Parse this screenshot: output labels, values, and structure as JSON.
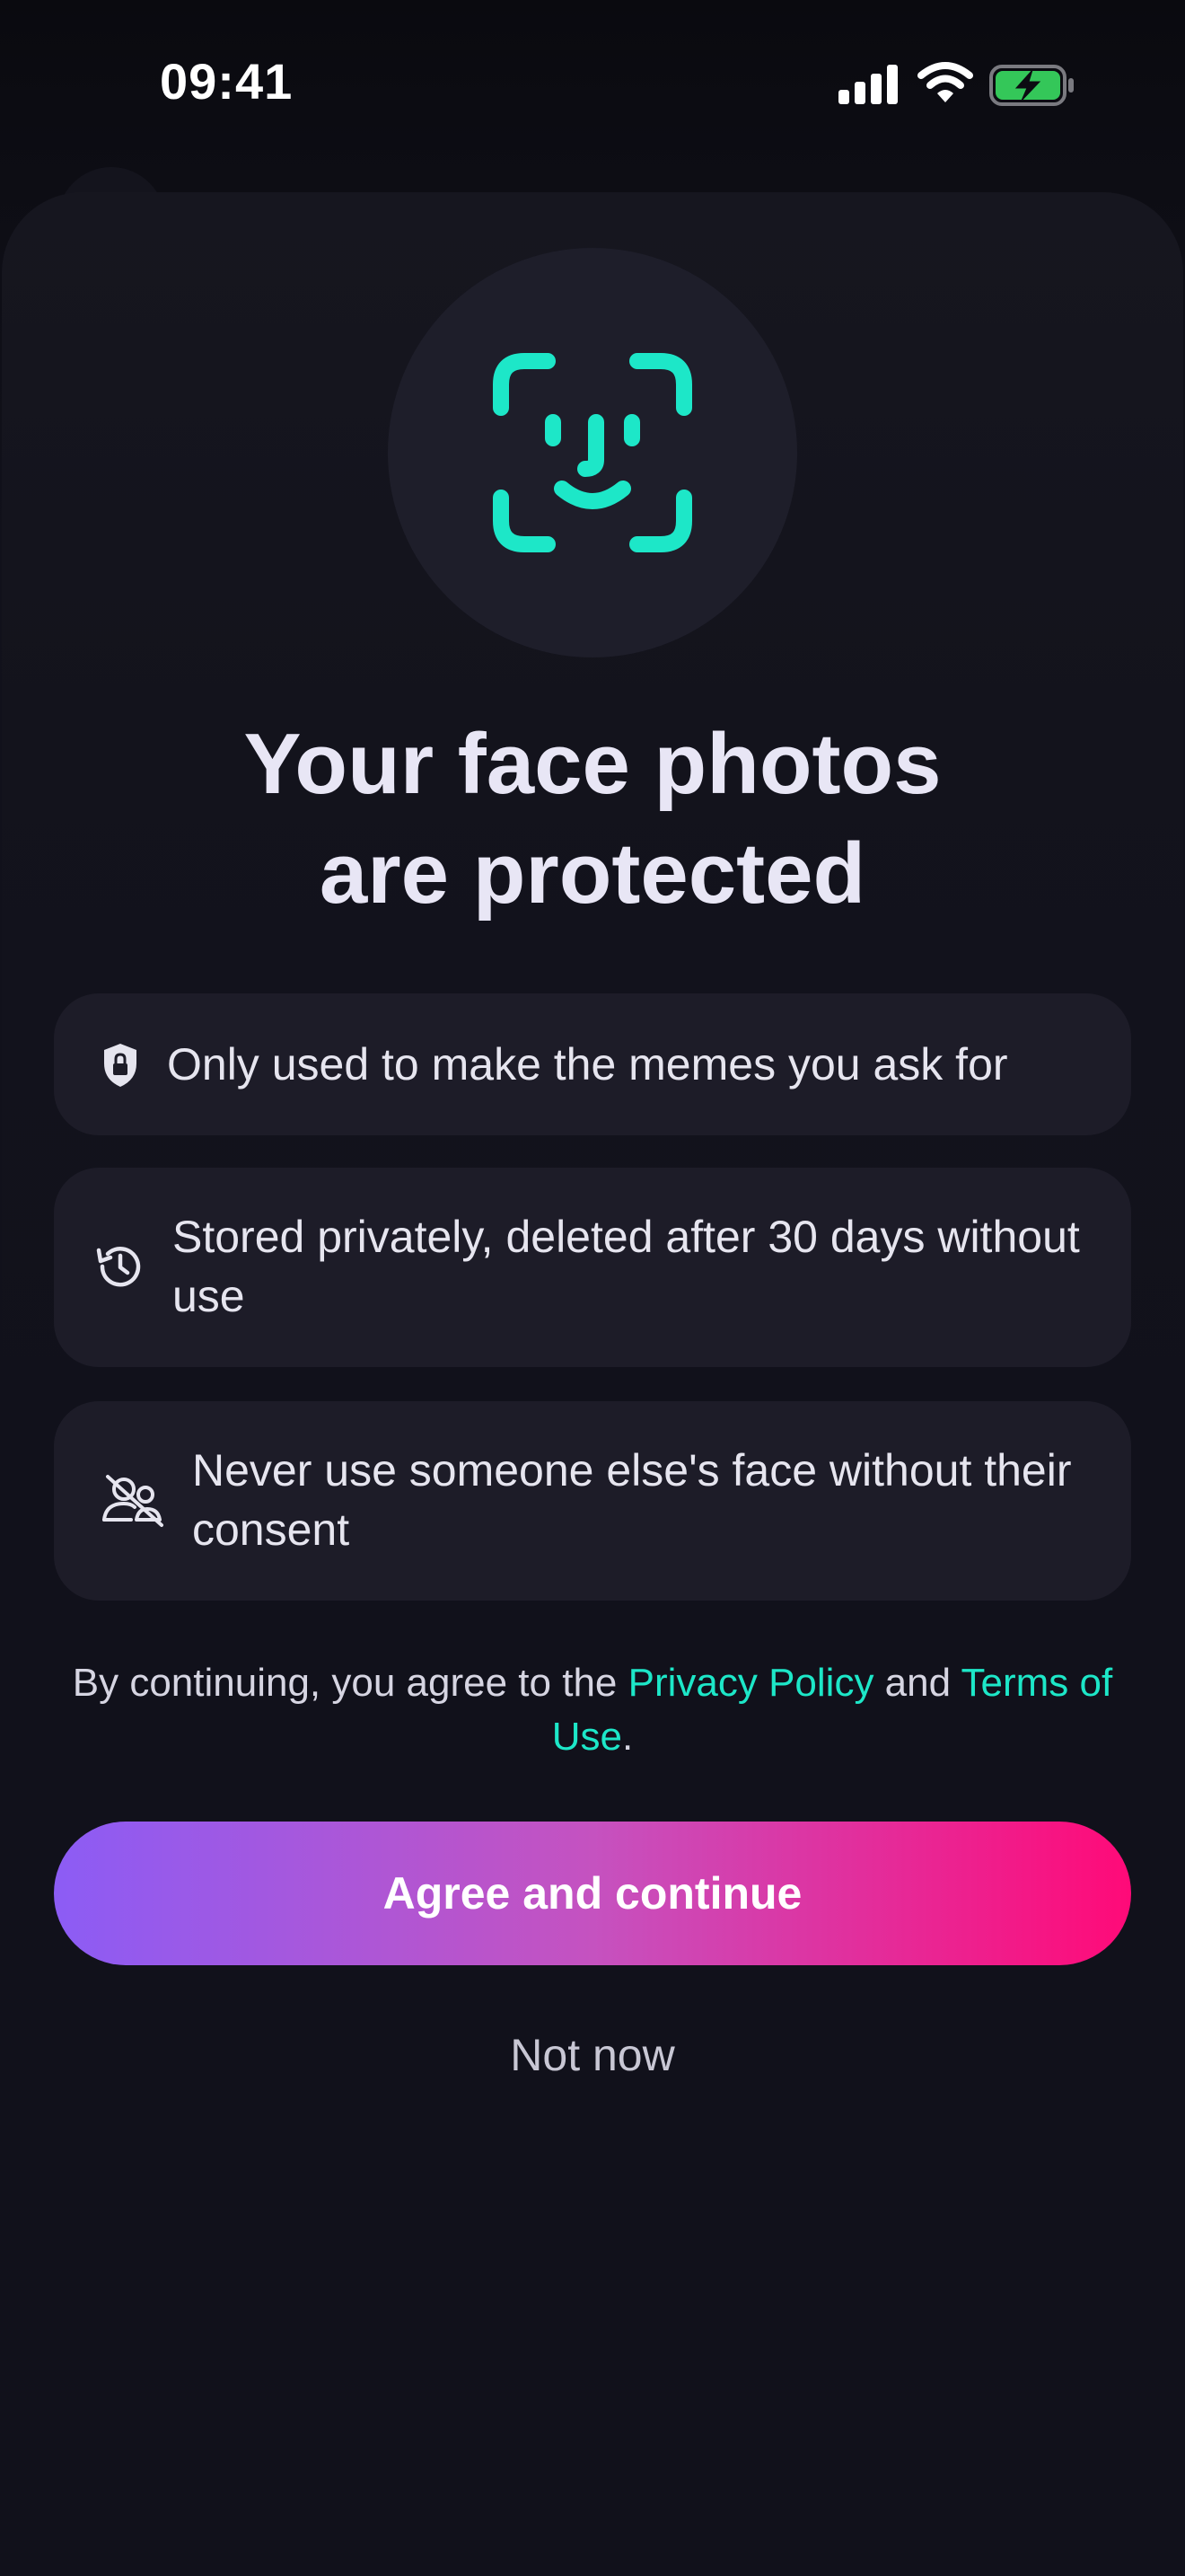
{
  "status_bar": {
    "time": "09:41",
    "icons": [
      "signal-icon",
      "wifi-icon",
      "battery-charging-icon"
    ]
  },
  "hero": {
    "icon": "face-id-icon",
    "title_line1": "Your face photos",
    "title_line2": "are protected"
  },
  "features": [
    {
      "icon": "shield-lock-icon",
      "text": "Only used to make the memes you ask for"
    },
    {
      "icon": "history-clock-icon",
      "text": "Stored privately, deleted after 30 days without use"
    },
    {
      "icon": "user-off-icon",
      "text": "Never use someone else's face without their consent"
    }
  ],
  "legal": {
    "prefix": "By continuing, you agree to the ",
    "privacy_link": "Privacy Policy",
    "middle": " and ",
    "terms_link": "Terms of Use",
    "suffix": "."
  },
  "actions": {
    "primary_label": "Agree and continue",
    "secondary_label": "Not now"
  },
  "colors": {
    "accent": "#1de7c8",
    "gradient_start": "#8c5cf5",
    "gradient_end": "#ff0a78",
    "background": "#11111b",
    "card": "#1d1c28",
    "battery": "#34c759"
  }
}
